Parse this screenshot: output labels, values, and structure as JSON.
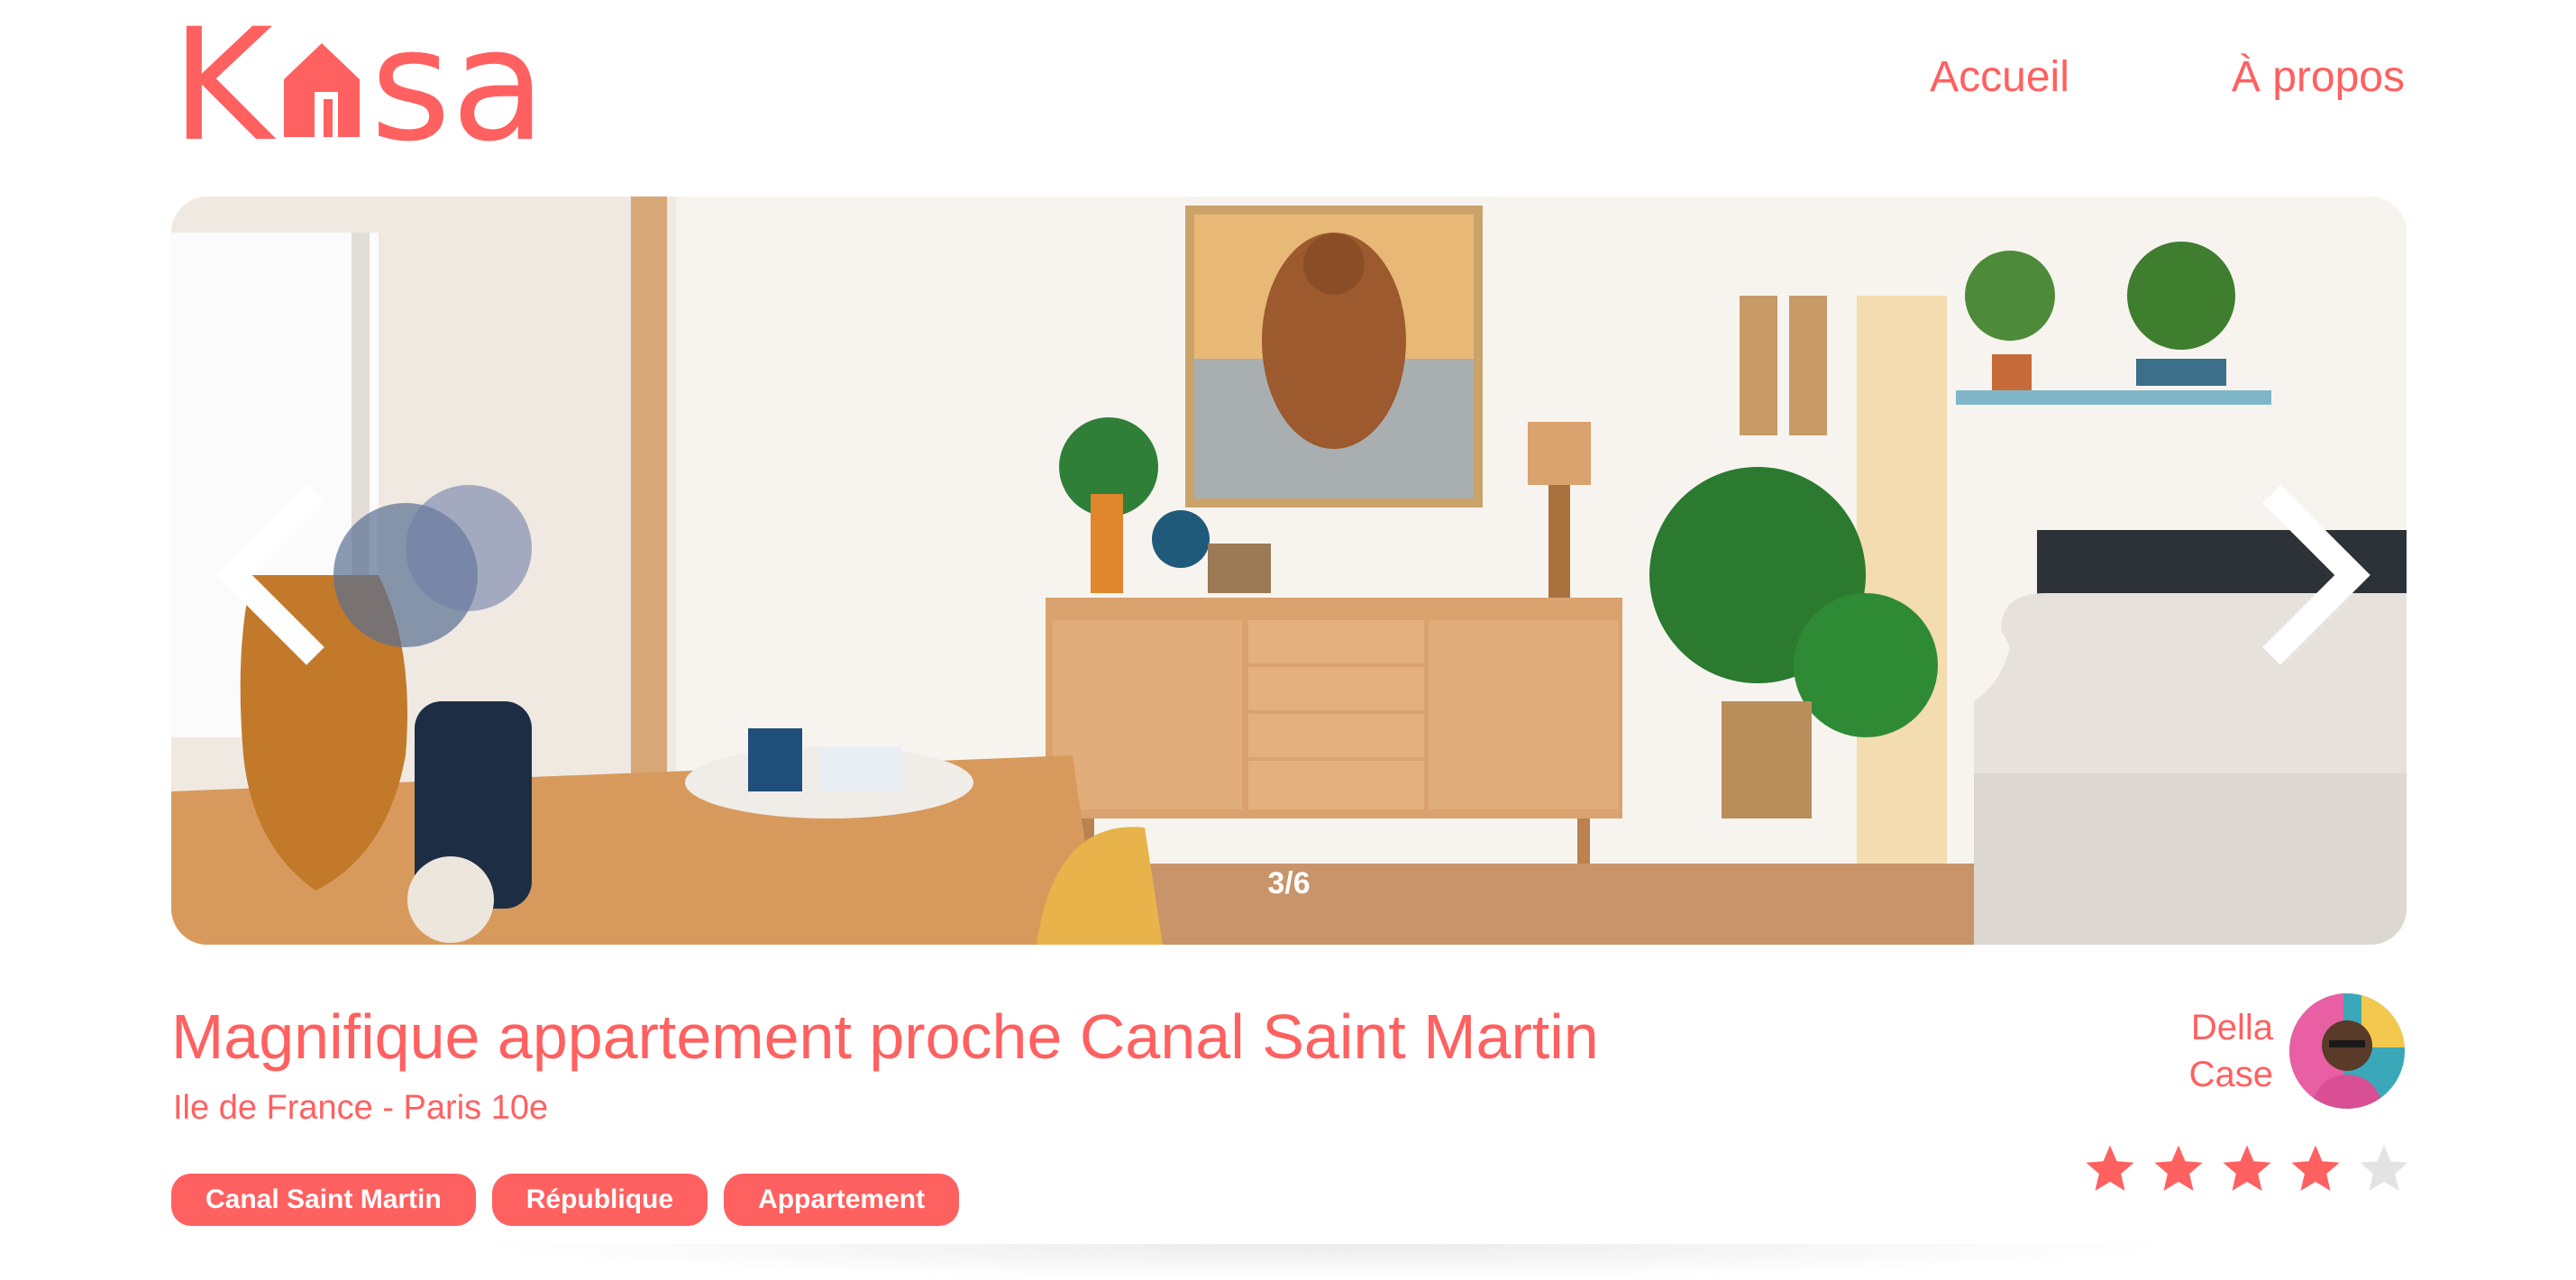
{
  "brand": {
    "logo_icon": "kasa-logo-house-icon",
    "accent_color": "#FF6060"
  },
  "nav": {
    "home": "Accueil",
    "about": "À propos"
  },
  "gallery": {
    "counter": "3/6",
    "prev_icon": "chevron-left-icon",
    "next_icon": "chevron-right-icon"
  },
  "listing": {
    "title": "Magnifique appartement proche Canal Saint Martin",
    "location": "Ile de France - Paris 10e",
    "tags": [
      "Canal Saint Martin",
      "République",
      "Appartement"
    ],
    "host": {
      "first_name": "Della",
      "last_name": "Case"
    },
    "rating": {
      "value": 4,
      "max": 5
    }
  }
}
